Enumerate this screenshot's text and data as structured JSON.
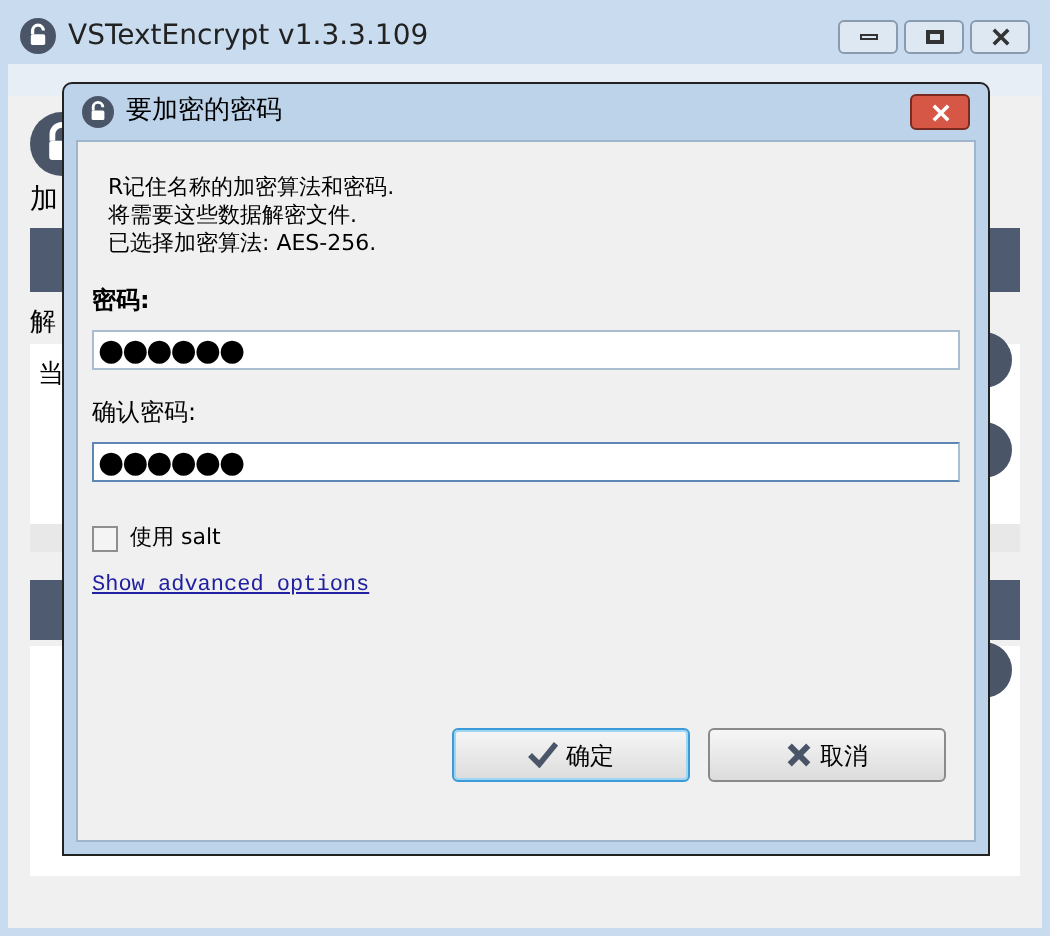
{
  "window": {
    "title": "VSTextEncrypt v1.3.3.109"
  },
  "background_fragments": {
    "toolbar_label": "加",
    "section_label": "解",
    "list_item": "当"
  },
  "dialog": {
    "title": "要加密的密码",
    "intro": [
      "R记住名称的加密算法和密码.",
      "将需要这些数据解密文件.",
      "已选择加密算法: AES-256."
    ],
    "fields": [
      {
        "label": "密码:",
        "value": "●●●●●●",
        "bold": true,
        "focused": false
      },
      {
        "label": "确认密码:",
        "value": "●●●●●●",
        "bold": false,
        "focused": true
      }
    ],
    "salt": {
      "label": "使用 salt",
      "checked": false
    },
    "link": "Show advanced options",
    "buttons": [
      {
        "label": "确定",
        "kind": "ok",
        "default": true
      },
      {
        "label": "取消",
        "kind": "cancel",
        "default": false
      }
    ]
  }
}
